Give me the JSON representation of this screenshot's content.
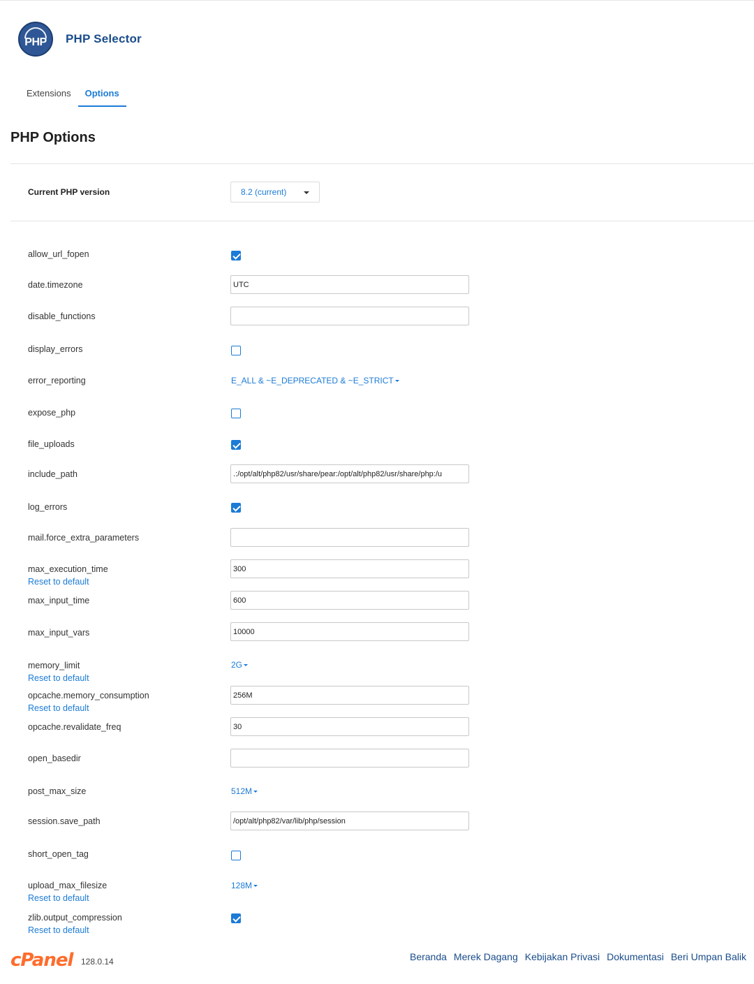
{
  "app": {
    "title": "PHP Selector",
    "logo_text": "PHP"
  },
  "tabs": [
    {
      "label": "Extensions",
      "active": false
    },
    {
      "label": "Options",
      "active": true
    }
  ],
  "page_title": "PHP Options",
  "version": {
    "label": "Current PHP version",
    "value": "8.2 (current)"
  },
  "reset_label": "Reset to default",
  "options": {
    "allow_url_fopen": {
      "label": "allow_url_fopen",
      "checked": true
    },
    "date_timezone": {
      "label": "date.timezone",
      "value": "UTC"
    },
    "disable_functions": {
      "label": "disable_functions",
      "value": ""
    },
    "display_errors": {
      "label": "display_errors",
      "checked": false
    },
    "error_reporting": {
      "label": "error_reporting",
      "value": "E_ALL & ~E_DEPRECATED & ~E_STRICT"
    },
    "expose_php": {
      "label": "expose_php",
      "checked": false
    },
    "file_uploads": {
      "label": "file_uploads",
      "checked": true
    },
    "include_path": {
      "label": "include_path",
      "value": ".:/opt/alt/php82/usr/share/pear:/opt/alt/php82/usr/share/php:/u"
    },
    "log_errors": {
      "label": "log_errors",
      "checked": true
    },
    "mail_force_extra_parameters": {
      "label": "mail.force_extra_parameters",
      "value": ""
    },
    "max_execution_time": {
      "label": "max_execution_time",
      "value": "300"
    },
    "max_input_time": {
      "label": "max_input_time",
      "value": "600"
    },
    "max_input_vars": {
      "label": "max_input_vars",
      "value": "10000"
    },
    "memory_limit": {
      "label": "memory_limit",
      "value": "2G"
    },
    "opcache_memory_consumption": {
      "label": "opcache.memory_consumption",
      "value": "256M"
    },
    "opcache_revalidate_freq": {
      "label": "opcache.revalidate_freq",
      "value": "30"
    },
    "open_basedir": {
      "label": "open_basedir",
      "value": ""
    },
    "post_max_size": {
      "label": "post_max_size",
      "value": "512M"
    },
    "session_save_path": {
      "label": "session.save_path",
      "value": "/opt/alt/php82/var/lib/php/session"
    },
    "short_open_tag": {
      "label": "short_open_tag",
      "checked": false
    },
    "upload_max_filesize": {
      "label": "upload_max_filesize",
      "value": "128M"
    },
    "zlib_output_compression": {
      "label": "zlib.output_compression",
      "checked": true
    }
  },
  "footer": {
    "brand": "cPanel",
    "version": "128.0.14",
    "links": [
      "Beranda",
      "Merek Dagang",
      "Kebijakan Privasi",
      "Dokumentasi",
      "Beri Umpan Balik"
    ]
  },
  "colors": {
    "accent": "#1b7bd6",
    "brand_blue": "#1a4c8a",
    "cpanel_orange": "#ff6c2c"
  }
}
